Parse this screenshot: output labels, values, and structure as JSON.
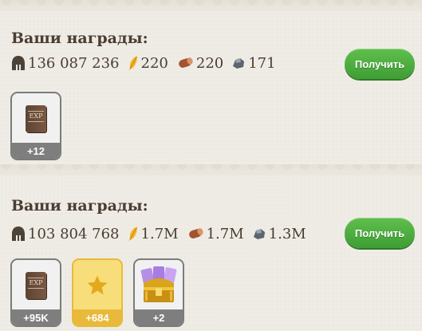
{
  "sections": [
    {
      "title": "Ваши награды:",
      "resources": [
        {
          "icon": "helmet-icon",
          "value": "136 087 236"
        },
        {
          "icon": "feather-icon",
          "value": "220"
        },
        {
          "icon": "wood-log-icon",
          "value": "220"
        },
        {
          "icon": "stone-icon",
          "value": "171"
        }
      ],
      "button": "Получить",
      "rewards": [
        {
          "icon": "exp-book-icon",
          "label": "EXP",
          "qty": "+12"
        }
      ]
    },
    {
      "title": "Ваши награды:",
      "resources": [
        {
          "icon": "helmet-icon",
          "value": "103 804 768"
        },
        {
          "icon": "feather-icon",
          "value": "1.7M"
        },
        {
          "icon": "wood-log-icon",
          "value": "1.7M"
        },
        {
          "icon": "stone-icon",
          "value": "1.3M"
        }
      ],
      "button": "Получить",
      "rewards": [
        {
          "icon": "exp-book-icon",
          "label": "EXP",
          "qty": "+95K"
        },
        {
          "icon": "star-icon",
          "qty": "+684"
        },
        {
          "icon": "treasure-chest-icon",
          "qty": "+2"
        }
      ]
    }
  ],
  "colors": {
    "background": "#efece5",
    "button": "#4caf3f",
    "text": "#4a3d31",
    "gold": "#e8b93a"
  }
}
